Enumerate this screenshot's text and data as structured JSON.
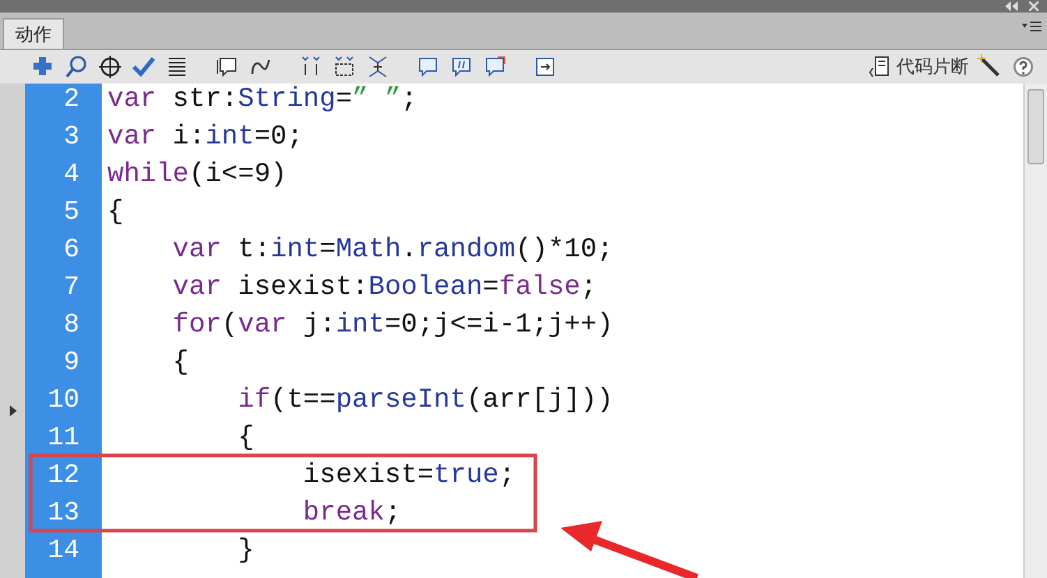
{
  "panel": {
    "tab": {
      "label": "动作",
      "selected": true
    },
    "snippets_button": {
      "label": "代码片断"
    }
  },
  "code": {
    "lines": [
      {
        "number": "2",
        "tokens": [
          {
            "text": "var",
            "kind": "keyword"
          },
          {
            "text": " str:",
            "kind": "plain"
          },
          {
            "text": "String",
            "kind": "type"
          },
          {
            "text": "=",
            "kind": "plain"
          },
          {
            "text": "” ”",
            "kind": "string"
          },
          {
            "text": ";",
            "kind": "plain"
          }
        ]
      },
      {
        "number": "3",
        "tokens": [
          {
            "text": "var",
            "kind": "keyword"
          },
          {
            "text": " i:",
            "kind": "plain"
          },
          {
            "text": "int",
            "kind": "type"
          },
          {
            "text": "=0;",
            "kind": "plain"
          }
        ]
      },
      {
        "number": "4",
        "tokens": [
          {
            "text": "while",
            "kind": "keyword"
          },
          {
            "text": "(i<=9)",
            "kind": "plain"
          }
        ]
      },
      {
        "number": "5",
        "tokens": [
          {
            "text": "{",
            "kind": "plain"
          }
        ]
      },
      {
        "number": "6",
        "tokens": [
          {
            "text": "    var",
            "kind": "keyword"
          },
          {
            "text": " t:",
            "kind": "plain"
          },
          {
            "text": "int",
            "kind": "type"
          },
          {
            "text": "=",
            "kind": "plain"
          },
          {
            "text": "Math",
            "kind": "type"
          },
          {
            "text": ".",
            "kind": "plain"
          },
          {
            "text": "random",
            "kind": "type"
          },
          {
            "text": "()*10;",
            "kind": "plain"
          }
        ]
      },
      {
        "number": "7",
        "tokens": [
          {
            "text": "    var",
            "kind": "keyword"
          },
          {
            "text": " isexist:",
            "kind": "plain"
          },
          {
            "text": "Boolean",
            "kind": "type"
          },
          {
            "text": "=",
            "kind": "plain"
          },
          {
            "text": "false",
            "kind": "keyword"
          },
          {
            "text": ";",
            "kind": "plain"
          }
        ]
      },
      {
        "number": "8",
        "tokens": [
          {
            "text": "    for",
            "kind": "keyword"
          },
          {
            "text": "(",
            "kind": "plain"
          },
          {
            "text": "var",
            "kind": "keyword"
          },
          {
            "text": " j:",
            "kind": "plain"
          },
          {
            "text": "int",
            "kind": "type"
          },
          {
            "text": "=0;j<=i-1;j++)",
            "kind": "plain"
          }
        ]
      },
      {
        "number": "9",
        "tokens": [
          {
            "text": "    {",
            "kind": "plain"
          }
        ]
      },
      {
        "number": "10",
        "tokens": [
          {
            "text": "        if",
            "kind": "keyword"
          },
          {
            "text": "(t==",
            "kind": "plain"
          },
          {
            "text": "parseInt",
            "kind": "type"
          },
          {
            "text": "(arr[j]))",
            "kind": "plain"
          }
        ]
      },
      {
        "number": "11",
        "tokens": [
          {
            "text": "        {",
            "kind": "plain"
          }
        ]
      },
      {
        "number": "12",
        "tokens": [
          {
            "text": "            isexist=",
            "kind": "plain"
          },
          {
            "text": "true",
            "kind": "type"
          },
          {
            "text": ";",
            "kind": "plain"
          }
        ]
      },
      {
        "number": "13",
        "tokens": [
          {
            "text": "            break",
            "kind": "keyword"
          },
          {
            "text": ";",
            "kind": "plain"
          }
        ]
      },
      {
        "number": "14",
        "tokens": [
          {
            "text": "        }",
            "kind": "plain"
          }
        ]
      }
    ]
  }
}
